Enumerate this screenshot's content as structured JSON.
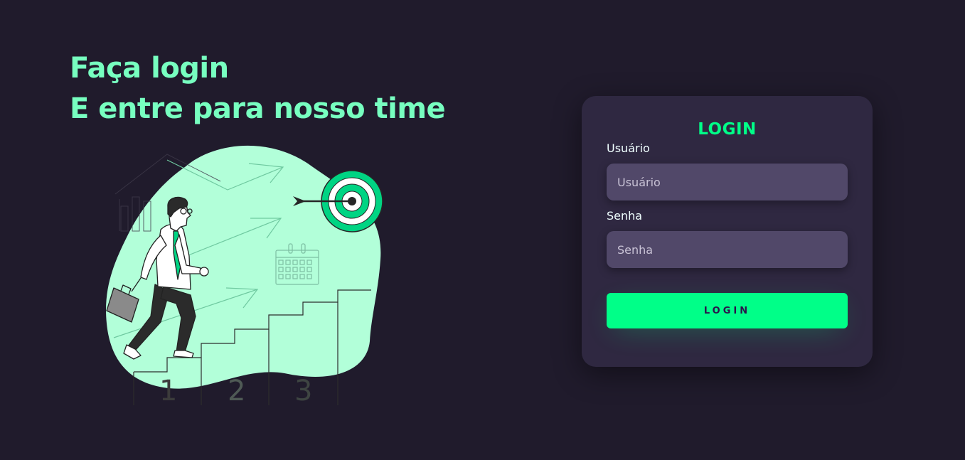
{
  "hero": {
    "line1": "Faça login",
    "line2": "E entre para nosso time"
  },
  "illustration": {
    "step_numbers": [
      "1",
      "2",
      "3"
    ]
  },
  "login_card": {
    "title": "LOGIN",
    "username": {
      "label": "Usuário",
      "placeholder": "Usuário",
      "value": ""
    },
    "password": {
      "label": "Senha",
      "placeholder": "Senha",
      "value": ""
    },
    "submit_label": "LOGIN"
  },
  "colors": {
    "background": "#201b2c",
    "heading": "#77ffc0",
    "accent": "#00ff88",
    "card": "#2f2841",
    "input": "#514869",
    "blob": "#b2ffd9"
  }
}
